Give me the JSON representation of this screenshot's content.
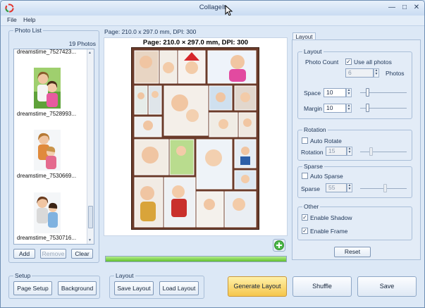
{
  "window": {
    "title": "CollageIt"
  },
  "menu": [
    "File",
    "Help"
  ],
  "photo_list": {
    "group_title": "Photo List",
    "count_text": "19 Photos",
    "items": [
      {
        "name": "dreamstime_7527423..."
      },
      {
        "name": "dreamstime_7528993..."
      },
      {
        "name": "dreamstime_7530669..."
      },
      {
        "name": "dreamstime_7530716..."
      }
    ],
    "add_label": "Add",
    "remove_label": "Remove",
    "clear_label": "Clear"
  },
  "page_info": "Page: 210.0 x 297.0 mm, DPI: 300",
  "preview_title": "Page: 210.0 × 297.0 mm, DPI: 300",
  "progress": 100,
  "setup": {
    "group_title": "Setup",
    "page_setup_label": "Page Setup",
    "background_label": "Background"
  },
  "layout_group": {
    "group_title": "Layout",
    "save_layout_label": "Save Layout",
    "load_layout_label": "Load Layout"
  },
  "actions": {
    "generate_label": "Generate Layout",
    "shuffle_label": "Shuffle",
    "save_label": "Save"
  },
  "settings": {
    "tab_label": "Layout",
    "layout": {
      "title": "Layout",
      "photo_count_label": "Photo Count",
      "use_all_label": "Use all photos",
      "use_all_checked": true,
      "photos_value": "6",
      "photos_unit": "Photos",
      "space_label": "Space",
      "space_value": "10",
      "margin_label": "Margin",
      "margin_value": "10"
    },
    "rotation": {
      "title": "Rotation",
      "auto_label": "Auto Rotate",
      "auto_checked": false,
      "rotation_label": "Rotation",
      "rotation_value": "15"
    },
    "sparse": {
      "title": "Sparse",
      "auto_label": "Auto Sparse",
      "auto_checked": false,
      "sparse_label": "Sparse",
      "sparse_value": "55"
    },
    "other": {
      "title": "Other",
      "shadow_label": "Enable Shadow",
      "shadow_checked": true,
      "frame_label": "Enable Frame",
      "frame_checked": true
    },
    "reset_label": "Reset"
  },
  "colors": {
    "accent": "#f5c64c",
    "frame": "#6b3b2a",
    "progress": "#5fbf2f"
  }
}
